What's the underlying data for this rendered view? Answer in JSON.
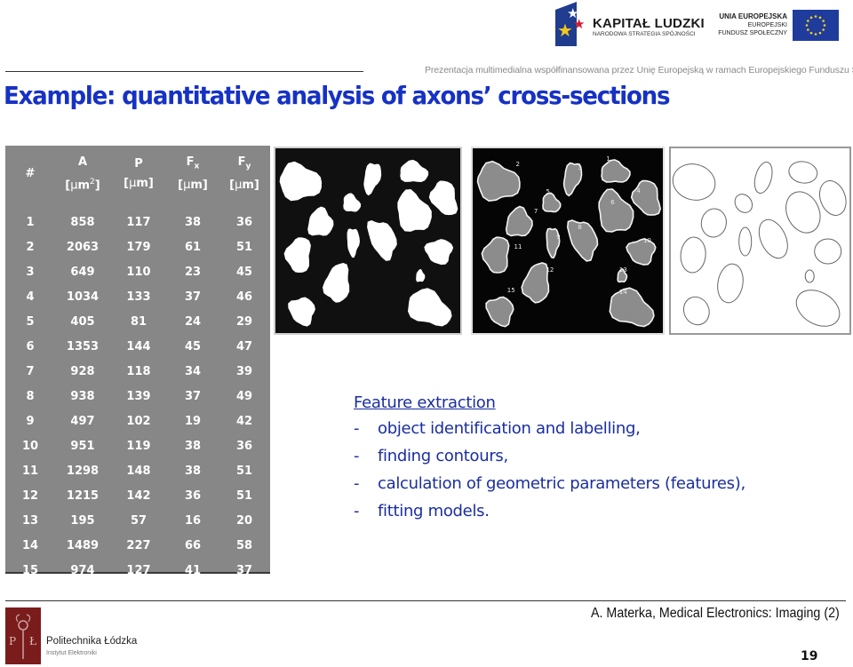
{
  "header": {
    "funding_note": "Prezentacja multimedialna współfinansowana przez Unię Europejską w ramach Europejskiego Funduszu Społecznego",
    "logo_kapital": {
      "title": "KAPITAŁ LUDZKI",
      "subtitle": "NARODOWA STRATEGIA SPÓJNOŚCI"
    },
    "logo_eu": {
      "line1": "UNIA EUROPEJSKA",
      "line2": "EUROPEJSKI",
      "line3": "FUNDUSZ SPOŁECZNY"
    }
  },
  "slide": {
    "title": "Example: quantitative analysis of axons’ cross-sections"
  },
  "table": {
    "headers": [
      {
        "name": "#",
        "unit": ""
      },
      {
        "name": "A",
        "unit_prefix": "[",
        "unit_mu": "μ",
        "unit_main": "m",
        "unit_sup": "2",
        "unit_suffix": "]"
      },
      {
        "name": "P",
        "unit_prefix": "[",
        "unit_mu": "μ",
        "unit_main": "m",
        "unit_sup": "",
        "unit_suffix": "]"
      },
      {
        "name": "F",
        "sub": "x",
        "unit_prefix": "[",
        "unit_mu": "μ",
        "unit_main": "m",
        "unit_sup": "",
        "unit_suffix": "]"
      },
      {
        "name": "F",
        "sub": "y",
        "unit_prefix": "[",
        "unit_mu": "μ",
        "unit_main": "m",
        "unit_sup": "",
        "unit_suffix": "]"
      }
    ],
    "rows": [
      [
        "1",
        "858",
        "117",
        "38",
        "36"
      ],
      [
        "2",
        "2063",
        "179",
        "61",
        "51"
      ],
      [
        "3",
        "649",
        "110",
        "23",
        "45"
      ],
      [
        "4",
        "1034",
        "133",
        "37",
        "46"
      ],
      [
        "5",
        "405",
        "81",
        "24",
        "29"
      ],
      [
        "6",
        "1353",
        "144",
        "45",
        "47"
      ],
      [
        "7",
        "928",
        "118",
        "34",
        "39"
      ],
      [
        "8",
        "938",
        "139",
        "37",
        "49"
      ],
      [
        "9",
        "497",
        "102",
        "19",
        "42"
      ],
      [
        "10",
        "951",
        "119",
        "38",
        "36"
      ],
      [
        "11",
        "1298",
        "148",
        "38",
        "51"
      ],
      [
        "12",
        "1215",
        "142",
        "36",
        "51"
      ],
      [
        "13",
        "195",
        "57",
        "16",
        "20"
      ],
      [
        "14",
        "1489",
        "227",
        "66",
        "58"
      ],
      [
        "15",
        "974",
        "127",
        "41",
        "37"
      ]
    ]
  },
  "images": {
    "binary": {
      "label": "binary-segmented-axons"
    },
    "contours": {
      "label": "labelled-contours",
      "labels": [
        "1",
        "2",
        "3",
        "4",
        "5",
        "6",
        "7",
        "8",
        "9",
        "10",
        "11",
        "12",
        "13",
        "14",
        "15"
      ]
    },
    "ellipses": {
      "label": "fitted-ellipse-models"
    }
  },
  "features": {
    "heading": "Feature extraction",
    "dash": "-",
    "items": [
      "object identification and labelling,",
      "finding contours,",
      "calculation of geometric parameters (features),",
      "fitting models."
    ]
  },
  "footer": {
    "author": "A. Materka, Medical Electronics: Imaging (2)",
    "page_number": "19",
    "institution": "Politechnika Łódzka",
    "institute": "Instytut Elektroniki",
    "logo_letters": "P Ł"
  },
  "colors": {
    "title_blue": "#1632c4",
    "text_blue": "#1a2ea0",
    "table_gray": "#878787",
    "pl_maroon": "#7b1c1c",
    "eu_blue": "#1f3c9c"
  }
}
